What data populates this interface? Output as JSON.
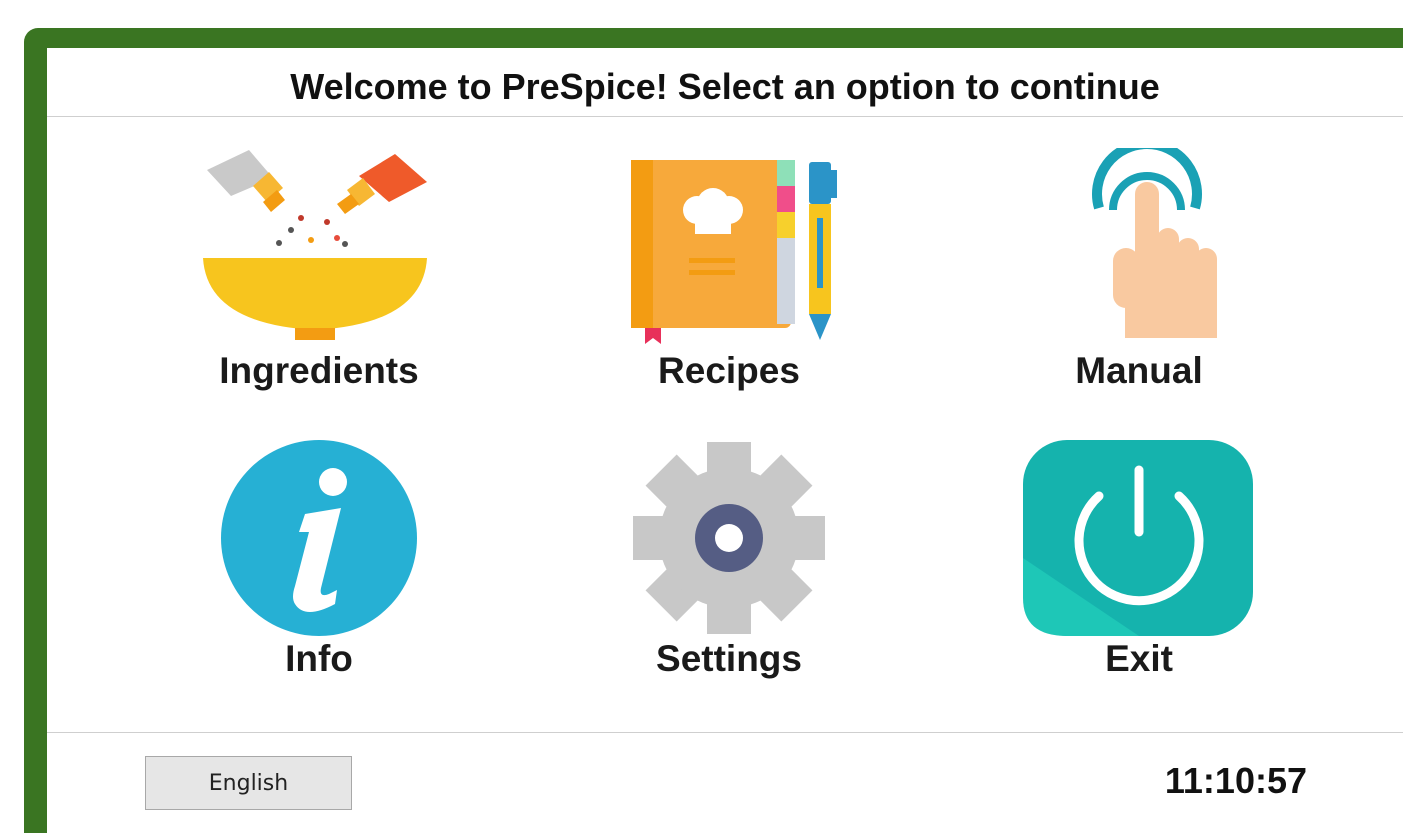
{
  "header": {
    "title": "Welcome to PreSpice! Select an option to continue"
  },
  "menu": {
    "items": [
      {
        "label": "Ingredients",
        "icon": "ingredients-bowl-icon"
      },
      {
        "label": "Recipes",
        "icon": "recipe-book-icon"
      },
      {
        "label": "Manual",
        "icon": "touch-hand-icon"
      },
      {
        "label": "Info",
        "icon": "info-icon"
      },
      {
        "label": "Settings",
        "icon": "gear-icon"
      },
      {
        "label": "Exit",
        "icon": "power-icon"
      }
    ]
  },
  "footer": {
    "language_label": "English",
    "clock": "11:10:57"
  },
  "colors": {
    "frame": "#3a7522",
    "info": "#26b0d4",
    "exit": "#15b3ad",
    "gear": "#c8c8c8",
    "gear_hub": "#555d84"
  }
}
